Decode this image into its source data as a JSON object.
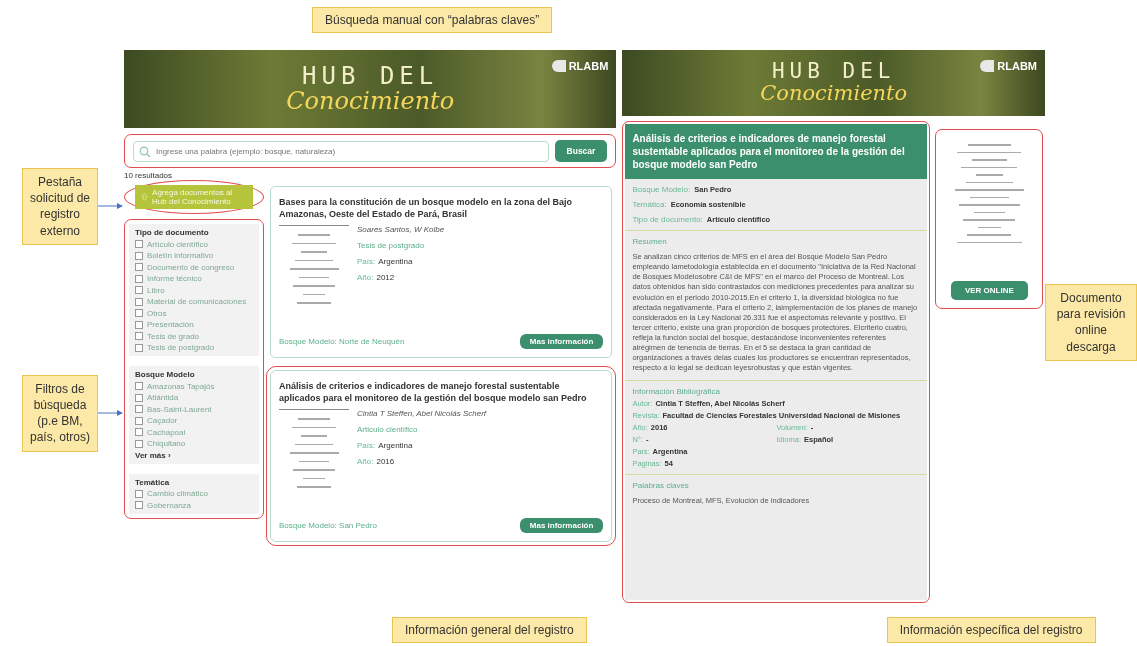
{
  "callouts": {
    "top": "Búsqueda manual con “palabras claves”",
    "tab_request": "Pestaña solicitud de registro externo",
    "filters": "Filtros de búsqueda (p.e BM, país, otros)",
    "document": "Documento para revisión online descarga",
    "general": "Información general del registro",
    "specific": "Información específica del  registro"
  },
  "banners": [
    {
      "line1": "HUB DEL",
      "line2": "Conocimiento",
      "logo": "RLABM"
    },
    {
      "line1": "HUB DEL",
      "line2": "Conocimiento",
      "logo": "RLABM"
    }
  ],
  "search": {
    "placeholder": "Ingrese una palabra (ejemplo: bosque, naturaleza)",
    "button": "Buscar"
  },
  "results_count": "10 resultados",
  "add_button": "Agrega documentos al Hub del Conocimiento",
  "filter_groups": [
    {
      "title": "Tipo de documento",
      "options": [
        {
          "label": "Artículo científico",
          "checked": false
        },
        {
          "label": "Boletín informativo",
          "checked": false
        },
        {
          "label": "Documento de congreso",
          "checked": false
        },
        {
          "label": "Informe técnico",
          "checked": false
        },
        {
          "label": "Libro",
          "checked": false
        },
        {
          "label": "Material de comunicaciones",
          "checked": false
        },
        {
          "label": "Otros",
          "checked": false
        },
        {
          "label": "Presentación",
          "checked": false
        },
        {
          "label": "Tesis de grado",
          "checked": false
        },
        {
          "label": "Tesis de postgrado",
          "checked": false
        }
      ]
    },
    {
      "title": "Bosque Modelo",
      "options": [
        {
          "label": "Amazonas Tapajós",
          "checked": false
        },
        {
          "label": "Atlántida",
          "checked": false
        },
        {
          "label": "Bas-Saint-Laurent",
          "checked": false
        },
        {
          "label": "Caçador",
          "checked": false
        },
        {
          "label": "Cachapoal",
          "checked": false
        },
        {
          "label": "Chiquitano",
          "checked": false
        }
      ],
      "more": "Ver más ›"
    },
    {
      "title": "Temática",
      "options": [
        {
          "label": "Cambio climático",
          "checked": false
        },
        {
          "label": "Gobernanza",
          "checked": false
        }
      ]
    }
  ],
  "results": [
    {
      "title": "Bases para la constitución de un bosque modelo en la zona del Bajo Amazonas, Oeste del Estado de Pará, Brasil",
      "authors": "Soares Santos, W Kolbe",
      "type": "Tesis de postgrado",
      "country_label": "País:",
      "country": "Argentina",
      "year_label": "Año:",
      "year": "2012",
      "forest": "Bosque Modelo: Norte de Neuquén",
      "button": "Mas información",
      "highlighted": false
    },
    {
      "title": "Análisis de criterios e indicadores de manejo forestal sustentable aplicados para el monitoreo de la gestión del bosque modelo san Pedro",
      "authors": "Cintia T Steffen, Abel Nicolás Scherf",
      "type": "Articulo científico",
      "country_label": "País:",
      "country": "Argentina",
      "year_label": "Año:",
      "year": "2016",
      "forest": "Bosque Modelo: San Pedro",
      "button": "Mas información",
      "highlighted": true
    }
  ],
  "detail": {
    "title": "Análisis de criterios e indicadores de manejo forestal sustentable aplicados para el monitoreo de la gestión del bosque modelo san Pedro",
    "fields": [
      {
        "label": "Bosque Modelo:",
        "value": "San Pedro"
      },
      {
        "label": "Temática:",
        "value": "Economía sostenible"
      },
      {
        "label": "Tipo de documento:",
        "value": "Artículo científico"
      }
    ],
    "abstract_title": "Resumen",
    "abstract": "Se analizan cinco criterios de MFS en el área del Bosque Modelo San Pedro empleando lametodología establecida en el documento \"Iniciativa de la Red Nacional de Bosques Modelosobre C&I de MFS\" en el marco del Proceso de Montreal. Los datos obtenidos han sido contrastados con mediciones precedentes para analizar su evolución en el periodo 2010-2015.En el criterio 1, la diversidad biológica no fue afectada negativamente. Para el criterio 2, laimplementación de los planes de manejo considerados en la Ley Nacional 26.331 fue el aspectomás relevante y positivo. El tercer criterio, existe una gran proporción de bosques protectores. Elcriterio cuatro, refleja la función social del bosque, destacándose inconvenientes referentes alrégimen de tenencia de tierras. En el 5 se destaca la gran cantidad de organizaciones a través delas cuales los productores se encuentran representados, respecto a lo legal se dedican leyesrobustas y que están vigentes.",
    "biblio_title": "Información Bibliográfica",
    "biblio_rows": [
      [
        {
          "label": "Autor:",
          "value": "Cintia T Steffen, Abel Nicolás Scherf"
        }
      ],
      [
        {
          "label": "Revista:",
          "value": "Facultad de Ciencias Forestales Universidad Nacional de Misiones"
        }
      ],
      [
        {
          "label": "Año:",
          "value": "2016"
        },
        {
          "label": "Volumen:",
          "value": "-"
        }
      ],
      [
        {
          "label": "N°:",
          "value": "-"
        },
        {
          "label": "Idioma:",
          "value": "Español"
        }
      ],
      [
        {
          "label": "País:",
          "value": "Argentina"
        }
      ],
      [
        {
          "label": "Paginas:",
          "value": "54"
        }
      ]
    ],
    "keywords_title": "Palabras claves",
    "keywords": "Proceso de Montreal, MFS, Evolución de indicadores"
  },
  "document_button": "VER ONLINE"
}
